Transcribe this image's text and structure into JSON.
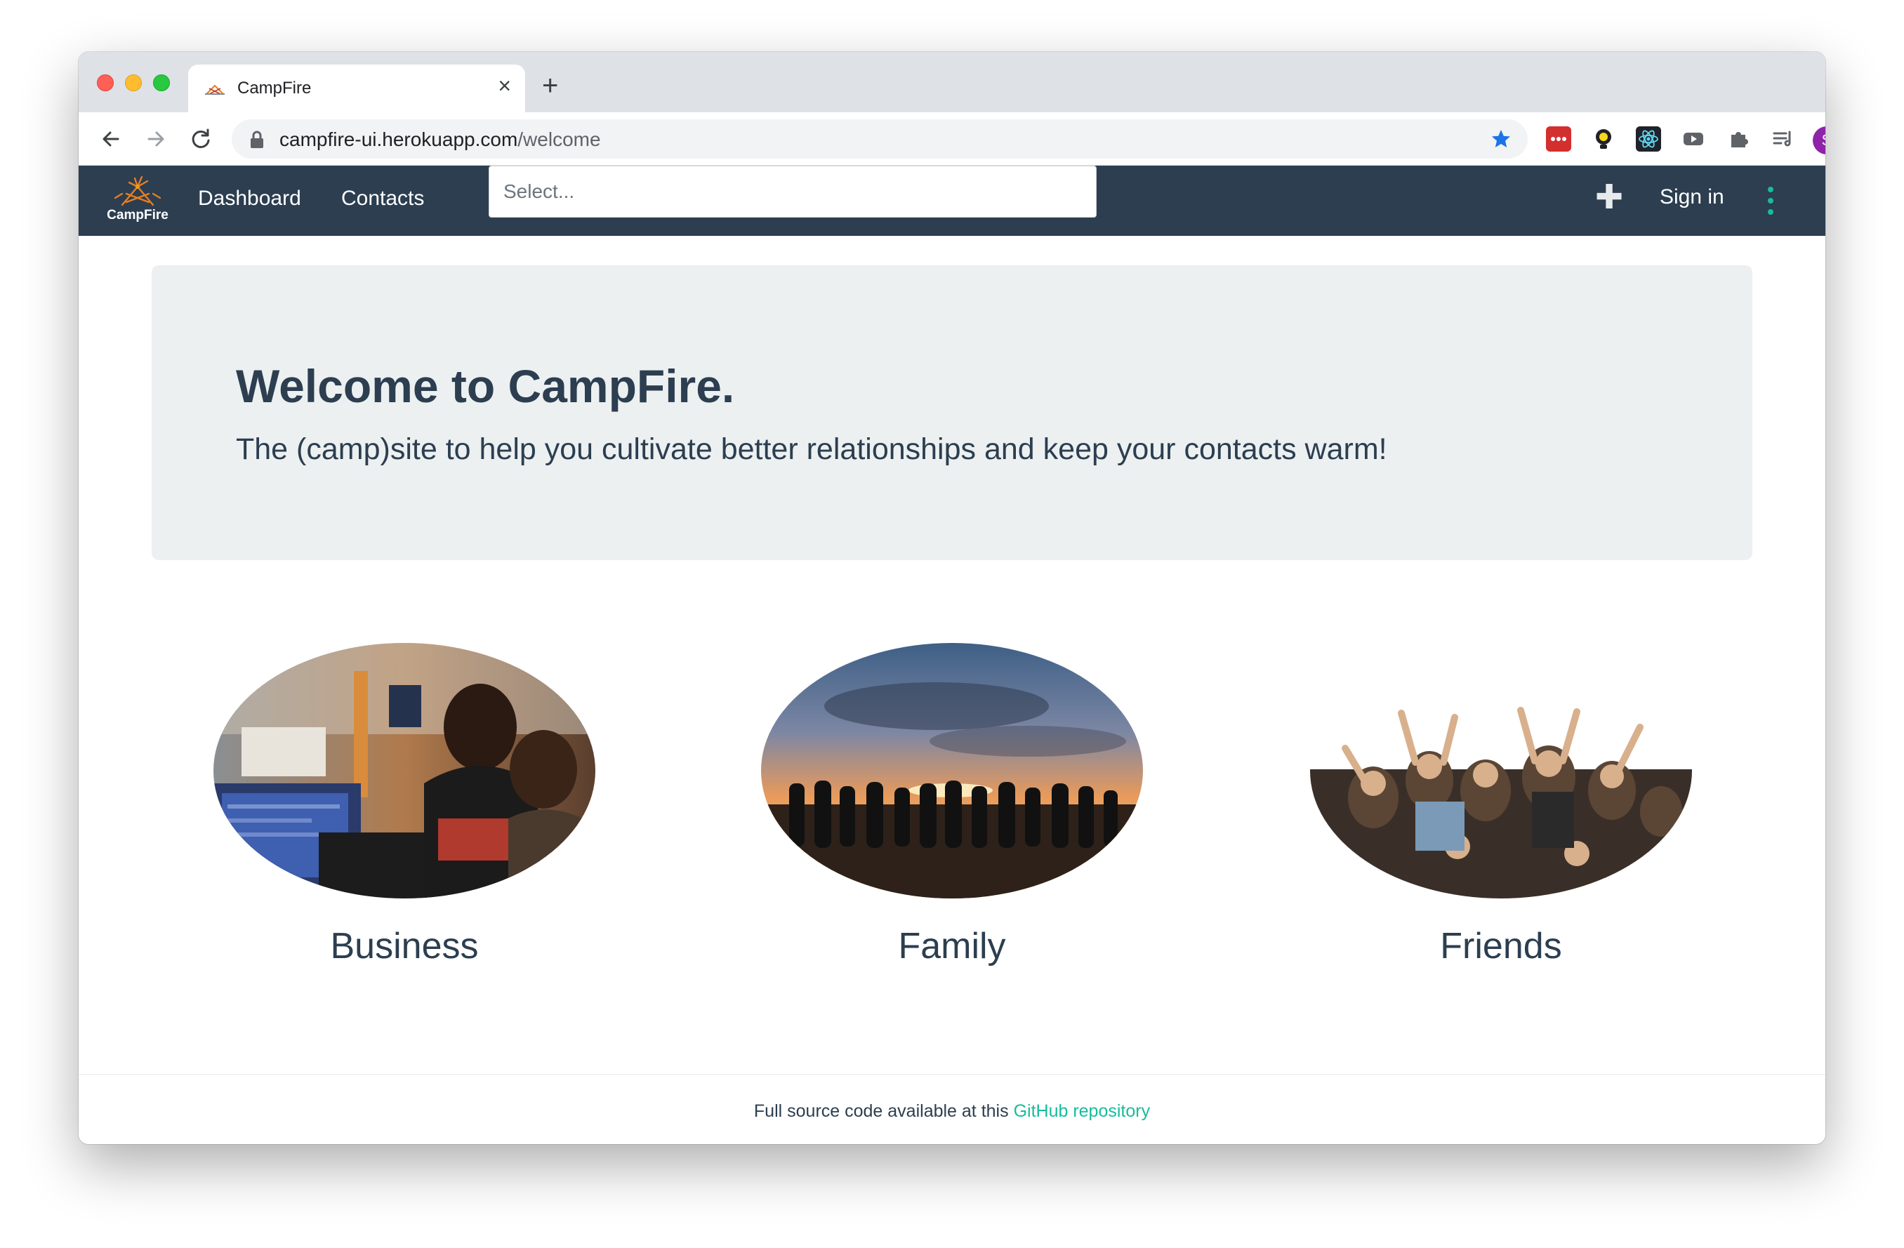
{
  "browser": {
    "tab_title": "CampFire",
    "tab_close": "×",
    "new_tab": "+",
    "url_host": "campfire-ui.herokuapp.com",
    "url_path": "/welcome",
    "profile_initial": "S",
    "profile_color": "#8e24aa",
    "bookmark_star_color": "#1a73e8",
    "extensions": [
      "lastpass-icon",
      "lightbulb-icon",
      "react-devtools-icon",
      "youtube-icon",
      "puzzle-icon",
      "media-playlist-icon"
    ]
  },
  "navbar": {
    "brand": "CampFire",
    "links": [
      "Dashboard",
      "Contacts"
    ],
    "search_placeholder": "Select...",
    "add_label": "✚",
    "signin": "Sign in",
    "background": "#2c3e50",
    "kebab_color": "#18bc9c"
  },
  "hero": {
    "title": "Welcome to CampFire.",
    "subtitle": "The (camp)site to help you cultivate better relationships and keep your contacts warm!"
  },
  "categories": [
    {
      "label": "Business"
    },
    {
      "label": "Family"
    },
    {
      "label": "Friends"
    }
  ],
  "footer": {
    "text": "Full source code available at this ",
    "link": "GitHub repository",
    "link_color": "#18bc9c"
  }
}
